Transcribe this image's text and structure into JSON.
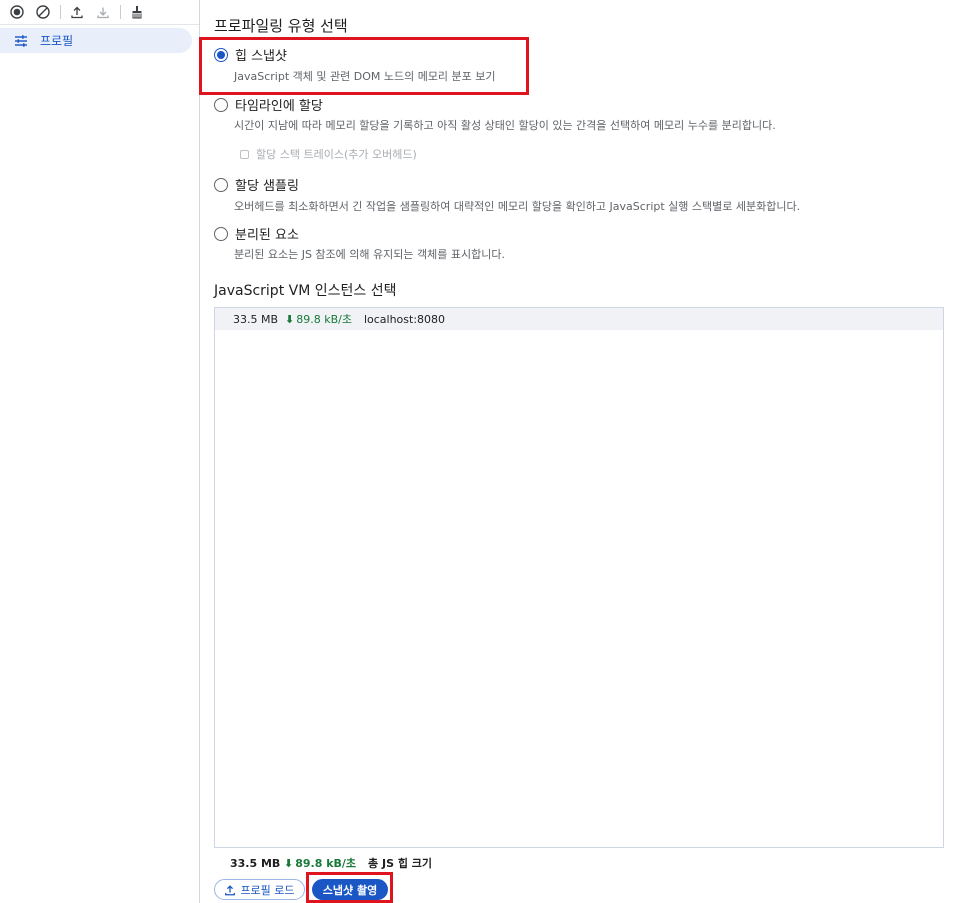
{
  "sidebar": {
    "toolbar_icons": [
      "record-icon",
      "clear-icon",
      "upload-icon",
      "download-icon",
      "garbage-collect-icon"
    ],
    "item_label": "프로필"
  },
  "main": {
    "section_title": "프로파일링 유형 선택",
    "options": [
      {
        "label": "힙 스냅샷",
        "desc": "JavaScript 객체 및 관련 DOM 노드의 메모리 분포 보기",
        "checked": true
      },
      {
        "label": "타임라인에 할당",
        "desc": "시간이 지남에 따라 메모리 할당을 기록하고 아직 활성 상태인 할당이 있는 간격을 선택하여 메모리 누수를 분리합니다.",
        "checked": false
      },
      {
        "label": "할당 샘플링",
        "desc": "오버헤드를 최소화하면서 긴 작업을 샘플링하여 대략적인 메모리 할당을 확인하고 JavaScript 실행 스택별로 세분화합니다.",
        "checked": false
      },
      {
        "label": "분리된 요소",
        "desc": "분리된 요소는 JS 참조에 의해 유지되는 객체를 표시합니다.",
        "checked": false
      }
    ],
    "stack_trace_checkbox": "할당 스택 트레이스(추가 오버헤드)",
    "vm_title": "JavaScript VM 인스턴스 선택",
    "vm_instances": [
      {
        "size": "33.5 MB",
        "speed": "89.8 kB/초",
        "host": "localhost:8080"
      }
    ],
    "total": {
      "size": "33.5 MB",
      "speed": "89.8 kB/초",
      "label": "총 JS 힙 크기"
    },
    "load_button": "프로필 로드",
    "snapshot_button": "스냅샷 촬영"
  },
  "colors": {
    "accent": "#1a56c4",
    "speed": "#18793a",
    "highlight": "#e0141e"
  }
}
